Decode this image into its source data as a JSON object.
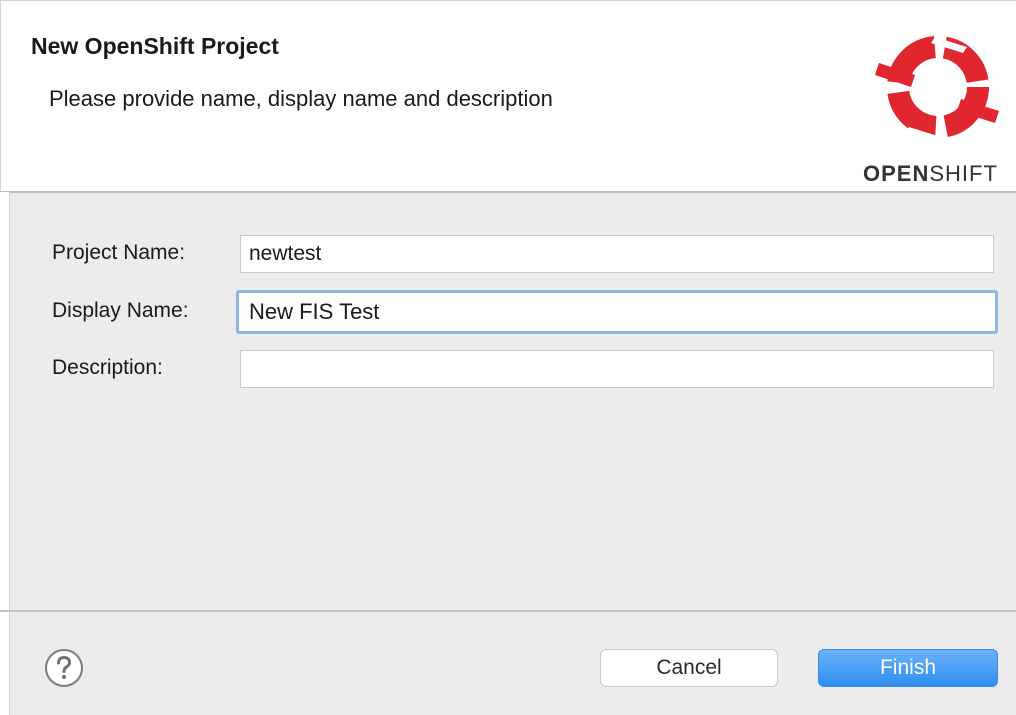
{
  "header": {
    "title": "New OpenShift Project",
    "subtitle": "Please provide name, display name and description",
    "logo_text_bold": "OPEN",
    "logo_text_rest": "SHIFT"
  },
  "form": {
    "project_name": {
      "label": "Project Name:",
      "value": "newtest"
    },
    "display_name": {
      "label": "Display Name:",
      "value": "New FIS Test"
    },
    "description": {
      "label": "Description:",
      "value": ""
    }
  },
  "footer": {
    "help_icon": "question-mark-circle-icon",
    "cancel_label": "Cancel",
    "finish_label": "Finish"
  },
  "colors": {
    "logo_red": "#e0262e",
    "focus_border": "#8fb5e8",
    "primary_button": "#2f8ff1"
  }
}
